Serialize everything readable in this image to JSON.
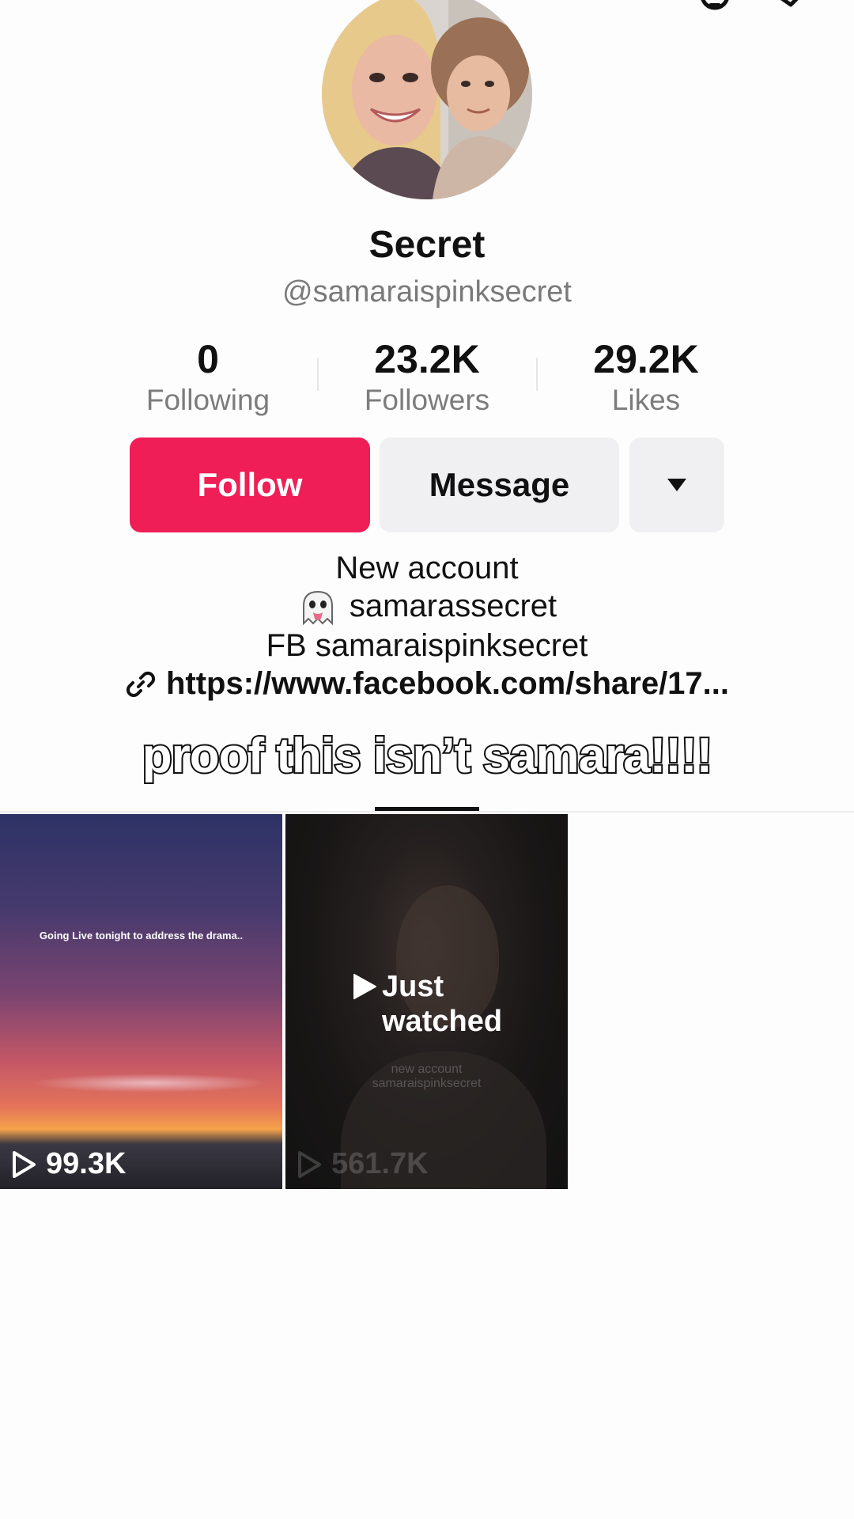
{
  "profile": {
    "display_name": "Secret",
    "handle": "@samaraispinksecret"
  },
  "stats": [
    {
      "value": "0",
      "label": "Following"
    },
    {
      "value": "23.2K",
      "label": "Followers"
    },
    {
      "value": "29.2K",
      "label": "Likes"
    }
  ],
  "actions": {
    "follow_label": "Follow",
    "message_label": "Message",
    "more_icon": "caret-down-icon"
  },
  "bio": {
    "line1": "New account",
    "line2": "samarassecret",
    "line3": "FB samaraispinksecret",
    "link": "https://www.facebook.com/share/17..."
  },
  "overlay_caption": "proof this isn’t samara!!!!",
  "videos": [
    {
      "overlay_text": "Going Live tonight to address the drama..",
      "views": "99.3K"
    },
    {
      "status_line1": "Just",
      "status_line2": "watched",
      "ghost_line1": "new account",
      "ghost_line2": "samaraispinksecret",
      "views": "561.7K"
    }
  ],
  "colors": {
    "follow": "#ef1e57",
    "secondary_button": "#f0f0f3"
  }
}
